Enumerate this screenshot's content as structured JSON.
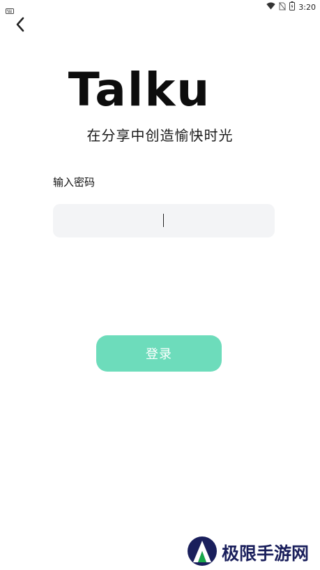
{
  "status_bar": {
    "time": "3:20",
    "icons": [
      "keyboard-icon",
      "wifi-icon",
      "no-sim-icon",
      "battery-icon"
    ]
  },
  "header": {
    "back_icon": "chevron-left-icon"
  },
  "logo": {
    "text": "Talku"
  },
  "tagline": "在分享中创造愉快时光",
  "password": {
    "label": "输入密码",
    "value": "",
    "placeholder": ""
  },
  "login_button": {
    "label": "登录",
    "color": "#6ddcbb"
  },
  "watermark": {
    "text": "极限手游网",
    "color": "#1a1f5c",
    "accent": "#18a84a"
  }
}
